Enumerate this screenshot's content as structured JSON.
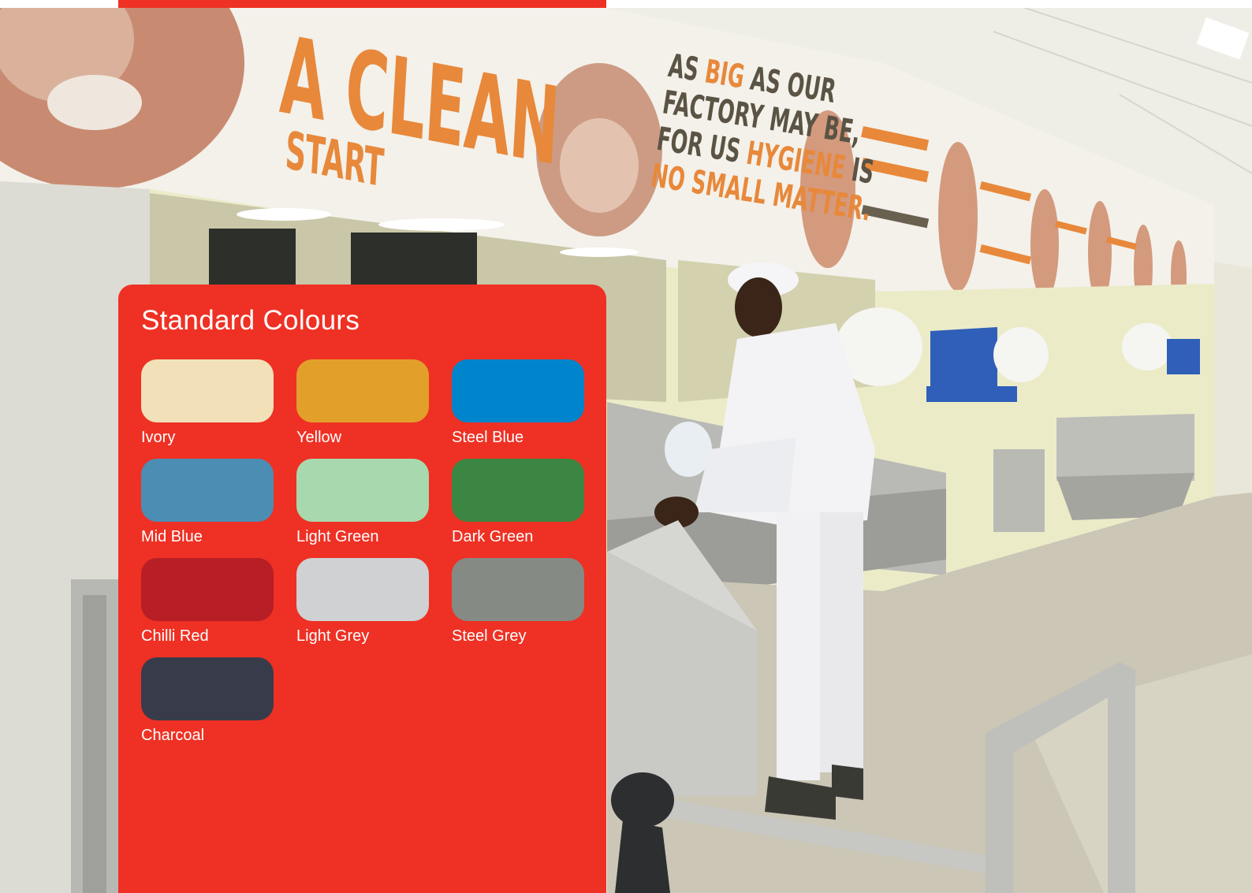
{
  "banner": {
    "headline_line1": "A CLEAN",
    "headline_line2": "START",
    "slogan": {
      "line1a": "AS ",
      "line1b": "BIG",
      "line1c": " AS OUR",
      "line2": "FACTORY MAY BE,",
      "line3a": "FOR US ",
      "line3b": "HYGIENE",
      "line3c": " IS",
      "line4": "NO SMALL MATTER."
    }
  },
  "panel": {
    "title": "Standard Colours",
    "background": "#ee3124",
    "swatches": [
      {
        "name": "Ivory",
        "color": "#f2e1b8"
      },
      {
        "name": "Yellow",
        "color": "#e2a02a"
      },
      {
        "name": "Steel Blue",
        "color": "#0084cc"
      },
      {
        "name": "Mid Blue",
        "color": "#4c8db3"
      },
      {
        "name": "Light Green",
        "color": "#a8d9ae"
      },
      {
        "name": "Dark Green",
        "color": "#3b8642"
      },
      {
        "name": "Chilli Red",
        "color": "#b81e26"
      },
      {
        "name": "Light Grey",
        "color": "#cfd1d3"
      },
      {
        "name": "Steel Grey",
        "color": "#868a84"
      },
      {
        "name": "Charcoal",
        "color": "#383c4a"
      }
    ]
  }
}
